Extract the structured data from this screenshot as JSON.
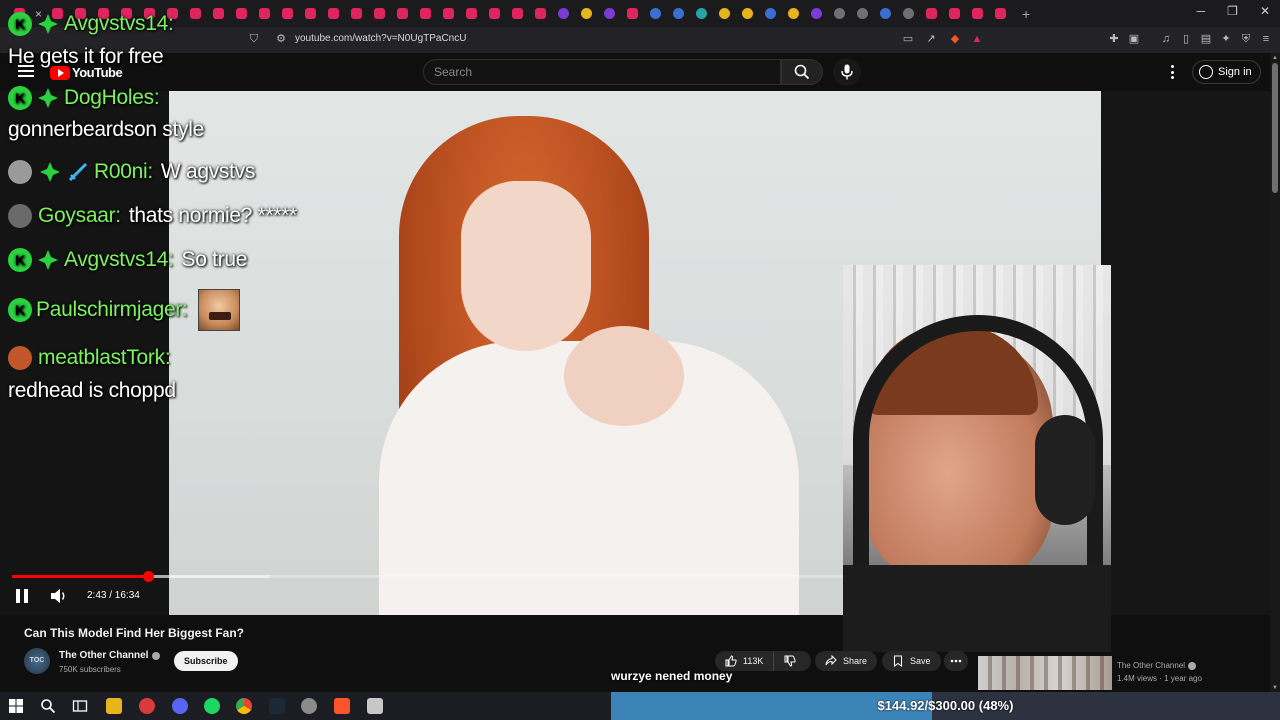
{
  "browser": {
    "url": "youtube.com/watch?v=N0UgTPaCncU"
  },
  "youtube": {
    "logo_text": "YouTube",
    "search_placeholder": "Search",
    "signin_label": "Sign in"
  },
  "player": {
    "current_time": "2:43",
    "duration": "16:34",
    "time_display": "2:43 / 16:34",
    "progress_fraction": 0.164,
    "buffered_fraction": 0.31,
    "playing": true
  },
  "video_info": {
    "title": "Can This Model Find Her Biggest Fan?",
    "channel_name": "The Other Channel",
    "channel_avatar_text": "TOC",
    "subscribers": "750K subscribers",
    "subscribe_label": "Subscribe",
    "likes": "113K",
    "share_label": "Share",
    "save_label": "Save"
  },
  "caption": "wurzye nened money",
  "related": {
    "channel": "The Other Channel",
    "meta": "1.4M views · 1 year ago"
  },
  "chat": [
    {
      "name": "Avgvstvs14:",
      "text": "",
      "badges": [
        "kick",
        "diamond"
      ]
    },
    {
      "name": "",
      "text": "He gets it for free",
      "badges": []
    },
    {
      "name": "DogHoles:",
      "text": "",
      "badges": [
        "kick",
        "diamond"
      ]
    },
    {
      "name": "",
      "text": "gonnerbeardson style",
      "badges": []
    },
    {
      "name": "R00ni:",
      "text": "W agvstvs",
      "badges": [
        "avatar",
        "diamond",
        "sword"
      ]
    },
    {
      "name": "Goysaar:",
      "text": "thats normie? *****",
      "badges": [
        "avatar"
      ]
    },
    {
      "name": "Avgvstvs14:",
      "text": "So true",
      "badges": [
        "kick",
        "diamond"
      ]
    },
    {
      "name": "Paulschirmjager:",
      "text": "",
      "badges": [
        "kick"
      ],
      "emote": "laughing-man-emote"
    },
    {
      "name": "meatblastTork:",
      "text": "",
      "badges": [
        "avatar"
      ]
    },
    {
      "name": "",
      "text": "redhead is choppd",
      "badges": []
    }
  ],
  "donation_goal": {
    "text": "$144.92/$300.00 (48%)",
    "fraction": 0.48
  },
  "colors": {
    "accent_red": "#ff0000",
    "chat_name_green": "#7cf25f",
    "kick_green": "#2ad23e",
    "goal_fill": "#3c84b8"
  }
}
